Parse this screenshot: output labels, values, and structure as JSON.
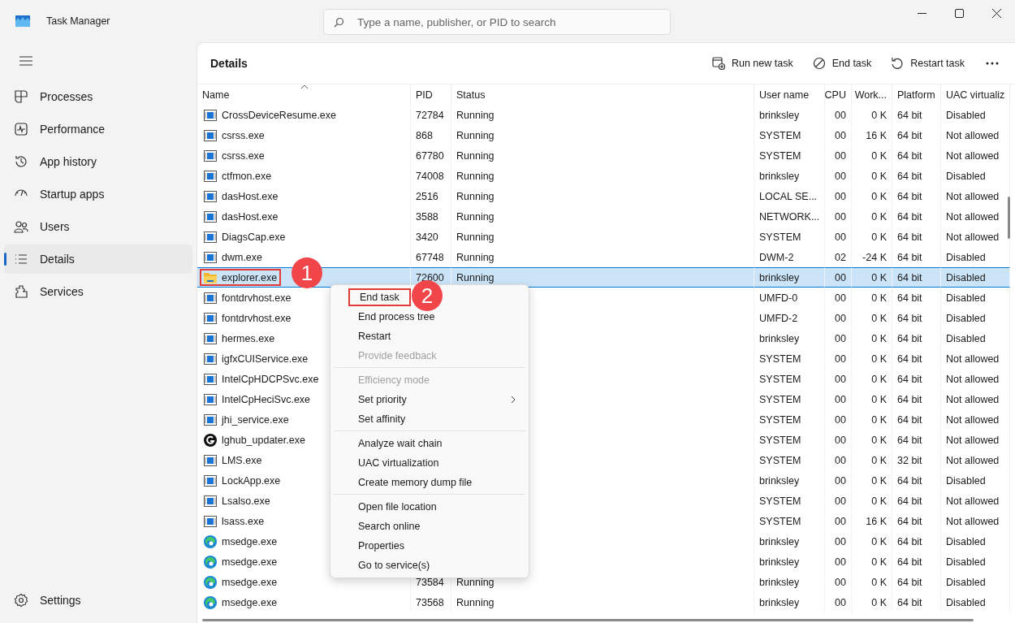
{
  "window": {
    "title": "Task Manager"
  },
  "search": {
    "placeholder": "Type a name, publisher, or PID to search"
  },
  "sidebar": {
    "items": [
      {
        "label": "Processes",
        "selected": false
      },
      {
        "label": "Performance",
        "selected": false
      },
      {
        "label": "App history",
        "selected": false
      },
      {
        "label": "Startup apps",
        "selected": false
      },
      {
        "label": "Users",
        "selected": false
      },
      {
        "label": "Details",
        "selected": true
      },
      {
        "label": "Services",
        "selected": false
      }
    ],
    "footer": {
      "label": "Settings"
    }
  },
  "page": {
    "title": "Details",
    "actions": [
      {
        "label": "Run new task"
      },
      {
        "label": "End task"
      },
      {
        "label": "Restart task"
      }
    ]
  },
  "table": {
    "columns": [
      {
        "label": "Name",
        "sorted": true
      },
      {
        "label": "PID",
        "sorted": false
      },
      {
        "label": "Status",
        "sorted": false
      },
      {
        "label": "User name",
        "sorted": false
      },
      {
        "label": "CPU",
        "sorted": false
      },
      {
        "label": "Work...",
        "sorted": false
      },
      {
        "label": "Platform",
        "sorted": false
      },
      {
        "label": "UAC virtualiz",
        "sorted": false
      }
    ],
    "rows": [
      {
        "kind": "app",
        "name": "CrossDeviceResume.exe",
        "pid": "72784",
        "status": "Running",
        "user": "brinksley",
        "cpu": "00",
        "memory": "0 K",
        "platform": "64 bit",
        "uac": "Disabled",
        "selected": false
      },
      {
        "kind": "app",
        "name": "csrss.exe",
        "pid": "868",
        "status": "Running",
        "user": "SYSTEM",
        "cpu": "00",
        "memory": "16 K",
        "platform": "64 bit",
        "uac": "Not allowed",
        "selected": false
      },
      {
        "kind": "app",
        "name": "csrss.exe",
        "pid": "67780",
        "status": "Running",
        "user": "SYSTEM",
        "cpu": "00",
        "memory": "0 K",
        "platform": "64 bit",
        "uac": "Not allowed",
        "selected": false
      },
      {
        "kind": "app",
        "name": "ctfmon.exe",
        "pid": "74008",
        "status": "Running",
        "user": "brinksley",
        "cpu": "00",
        "memory": "0 K",
        "platform": "64 bit",
        "uac": "Disabled",
        "selected": false
      },
      {
        "kind": "app",
        "name": "dasHost.exe",
        "pid": "2516",
        "status": "Running",
        "user": "LOCAL SE...",
        "cpu": "00",
        "memory": "0 K",
        "platform": "64 bit",
        "uac": "Not allowed",
        "selected": false
      },
      {
        "kind": "app",
        "name": "dasHost.exe",
        "pid": "3588",
        "status": "Running",
        "user": "NETWORK...",
        "cpu": "00",
        "memory": "0 K",
        "platform": "64 bit",
        "uac": "Not allowed",
        "selected": false
      },
      {
        "kind": "app",
        "name": "DiagsCap.exe",
        "pid": "3420",
        "status": "Running",
        "user": "SYSTEM",
        "cpu": "00",
        "memory": "0 K",
        "platform": "64 bit",
        "uac": "Not allowed",
        "selected": false
      },
      {
        "kind": "app",
        "name": "dwm.exe",
        "pid": "67748",
        "status": "Running",
        "user": "DWM-2",
        "cpu": "02",
        "memory": "-24 K",
        "platform": "64 bit",
        "uac": "Disabled",
        "selected": false
      },
      {
        "kind": "folder",
        "name": "explorer.exe",
        "pid": "72600",
        "status": "Running",
        "user": "brinksley",
        "cpu": "00",
        "memory": "0 K",
        "platform": "64 bit",
        "uac": "Disabled",
        "selected": true,
        "callout": "1"
      },
      {
        "kind": "app",
        "name": "fontdrvhost.exe",
        "user": "UMFD-0",
        "cpu": "00",
        "memory": "0 K",
        "platform": "64 bit",
        "uac": "Disabled",
        "selected": false
      },
      {
        "kind": "app",
        "name": "fontdrvhost.exe",
        "user": "UMFD-2",
        "cpu": "00",
        "memory": "0 K",
        "platform": "64 bit",
        "uac": "Disabled",
        "selected": false
      },
      {
        "kind": "app",
        "name": "hermes.exe",
        "user": "brinksley",
        "cpu": "00",
        "memory": "0 K",
        "platform": "64 bit",
        "uac": "Disabled",
        "selected": false
      },
      {
        "kind": "app",
        "name": "igfxCUIService.exe",
        "user": "SYSTEM",
        "cpu": "00",
        "memory": "0 K",
        "platform": "64 bit",
        "uac": "Not allowed",
        "selected": false
      },
      {
        "kind": "app",
        "name": "IntelCpHDCPSvc.exe",
        "user": "SYSTEM",
        "cpu": "00",
        "memory": "0 K",
        "platform": "64 bit",
        "uac": "Not allowed",
        "selected": false
      },
      {
        "kind": "app",
        "name": "IntelCpHeciSvc.exe",
        "user": "SYSTEM",
        "cpu": "00",
        "memory": "0 K",
        "platform": "64 bit",
        "uac": "Not allowed",
        "selected": false
      },
      {
        "kind": "app",
        "name": "jhi_service.exe",
        "user": "SYSTEM",
        "cpu": "00",
        "memory": "0 K",
        "platform": "64 bit",
        "uac": "Not allowed",
        "selected": false
      },
      {
        "kind": "logo",
        "name": "lghub_updater.exe",
        "user": "SYSTEM",
        "cpu": "00",
        "memory": "0 K",
        "platform": "64 bit",
        "uac": "Not allowed",
        "selected": false
      },
      {
        "kind": "app",
        "name": "LMS.exe",
        "user": "SYSTEM",
        "cpu": "00",
        "memory": "0 K",
        "platform": "32 bit",
        "uac": "Not allowed",
        "selected": false
      },
      {
        "kind": "app",
        "name": "LockApp.exe",
        "user": "brinksley",
        "cpu": "00",
        "memory": "0 K",
        "platform": "64 bit",
        "uac": "Disabled",
        "selected": false
      },
      {
        "kind": "app",
        "name": "Lsalso.exe",
        "user": "SYSTEM",
        "cpu": "00",
        "memory": "0 K",
        "platform": "64 bit",
        "uac": "Not allowed",
        "selected": false
      },
      {
        "kind": "app",
        "name": "lsass.exe",
        "user": "SYSTEM",
        "cpu": "00",
        "memory": "16 K",
        "platform": "64 bit",
        "uac": "Not allowed",
        "selected": false
      },
      {
        "kind": "edge",
        "name": "msedge.exe",
        "user": "brinksley",
        "cpu": "00",
        "memory": "0 K",
        "platform": "64 bit",
        "uac": "Disabled",
        "selected": false
      },
      {
        "kind": "edge",
        "name": "msedge.exe",
        "user": "brinksley",
        "cpu": "00",
        "memory": "0 K",
        "platform": "64 bit",
        "uac": "Disabled",
        "selected": false
      },
      {
        "kind": "edge",
        "name": "msedge.exe",
        "pid": "73584",
        "status": "Running",
        "user": "brinksley",
        "cpu": "00",
        "memory": "0 K",
        "platform": "64 bit",
        "uac": "Disabled",
        "selected": false
      },
      {
        "kind": "edge",
        "name": "msedge.exe",
        "pid": "73568",
        "status": "Running",
        "user": "brinksley",
        "cpu": "00",
        "memory": "0 K",
        "platform": "64 bit",
        "uac": "Disabled",
        "selected": false
      }
    ]
  },
  "context_menu": {
    "groups": [
      [
        {
          "label": "End task",
          "disabled": false,
          "submenu": false,
          "callout": "2"
        },
        {
          "label": "End process tree",
          "disabled": false,
          "submenu": false
        },
        {
          "label": "Restart",
          "disabled": false,
          "submenu": false
        },
        {
          "label": "Provide feedback",
          "disabled": true,
          "submenu": false
        }
      ],
      [
        {
          "label": "Efficiency mode",
          "disabled": true,
          "submenu": false
        },
        {
          "label": "Set priority",
          "disabled": false,
          "submenu": true
        },
        {
          "label": "Set affinity",
          "disabled": false,
          "submenu": false
        }
      ],
      [
        {
          "label": "Analyze wait chain",
          "disabled": false,
          "submenu": false
        },
        {
          "label": "UAC virtualization",
          "disabled": false,
          "submenu": false
        },
        {
          "label": "Create memory dump file",
          "disabled": false,
          "submenu": false
        }
      ],
      [
        {
          "label": "Open file location",
          "disabled": false,
          "submenu": false
        },
        {
          "label": "Search online",
          "disabled": false,
          "submenu": false
        },
        {
          "label": "Properties",
          "disabled": false,
          "submenu": false
        },
        {
          "label": "Go to service(s)",
          "disabled": false,
          "submenu": false
        }
      ]
    ]
  }
}
